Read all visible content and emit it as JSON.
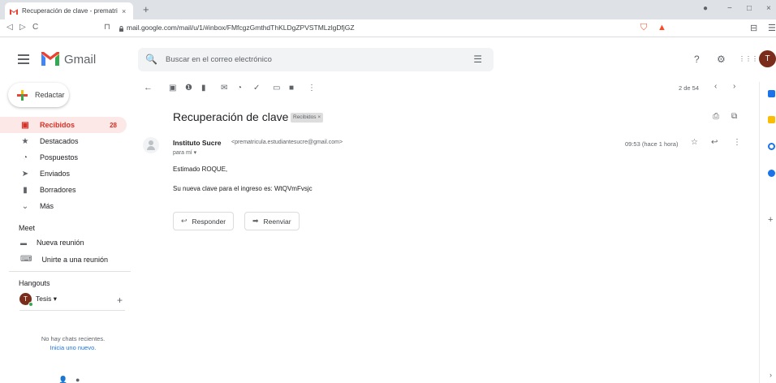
{
  "browser": {
    "tab_title": "Recuperación de clave - prematri",
    "tab_close": "×",
    "new_tab": "+",
    "url": "mail.google.com/mail/u/1/#inbox/FMfcgzGmthdThKLDgZPVSTMLzlgDfjGZ",
    "nav": {
      "back": "◁",
      "forward": "▷",
      "reload": "C",
      "bookmark": "⊓"
    },
    "window": {
      "minimize": "−",
      "maximize": "□",
      "close": "×",
      "profile": "●"
    },
    "ext_icons": {
      "shield": "⛉",
      "triangle": "▲",
      "sidebar": "⊟",
      "menu": "☰"
    },
    "icons": [
      "back-icon",
      "forward-icon",
      "reload-icon",
      "bookmark-icon",
      "lock-icon",
      "brave-shield-icon",
      "rewards-icon"
    ]
  },
  "header": {
    "app_name": "Gmail",
    "search_placeholder": "Buscar en el correo electrónico",
    "icon_glyphs": {
      "search": "🔍",
      "tune": "☰",
      "help": "?",
      "settings": "⚙",
      "apps": "⋮⋮⋮"
    },
    "avatar_letter": "T",
    "icons": [
      "menu-icon",
      "gmail-logo",
      "search-icon",
      "tune-icon",
      "help-icon",
      "settings-icon",
      "apps-icon"
    ]
  },
  "compose": {
    "label": "Redactar"
  },
  "sidebar": {
    "items": [
      {
        "label": "Recibidos",
        "count": "28",
        "icon": "inbox-icon",
        "glyph": "▣",
        "active": true
      },
      {
        "label": "Destacados",
        "icon": "star-icon",
        "glyph": "★"
      },
      {
        "label": "Pospuestos",
        "icon": "clock-icon",
        "glyph": "◔"
      },
      {
        "label": "Enviados",
        "icon": "send-icon",
        "glyph": "➤"
      },
      {
        "label": "Borradores",
        "icon": "draft-icon",
        "glyph": "▮"
      },
      {
        "label": "Más",
        "icon": "chevron-down-icon",
        "glyph": "⌄"
      }
    ],
    "meet": {
      "title": "Meet",
      "new_meeting": "Nueva reunión",
      "join_meeting": "Unirte a una reunión",
      "icons": {
        "video": "▬",
        "keyboard": "⌨"
      }
    },
    "hangouts": {
      "title": "Hangouts",
      "user": "Tesis ▾",
      "avatar_letter": "T",
      "add": "+",
      "no_chats": "No hay chats recientes.",
      "start_new": "Inicia uno nuevo."
    }
  },
  "toolbar": {
    "icon_glyphs": {
      "back": "←",
      "archive": "▣",
      "report": "❶",
      "delete": "▮",
      "mark_unread": "✉",
      "snooze": "◔",
      "add_task": "✓",
      "move": "▭",
      "label": "■",
      "more": "⋮"
    },
    "pager_text": "2 de 54",
    "prev": "‹",
    "next": "›",
    "icons": [
      "back-arrow-icon",
      "archive-icon",
      "report-spam-icon",
      "trash-icon",
      "mark-unread-icon",
      "snooze-icon",
      "add-task-icon",
      "move-to-icon",
      "label-icon",
      "more-icon"
    ]
  },
  "message": {
    "subject": "Recuperación de clave",
    "label_chip": "Recibidos ×",
    "subject_icons": {
      "print": "⎙",
      "open_new": "⧉"
    },
    "sender_name": "Instituto Sucre",
    "sender_email": "<prematricula.estudiantesucre@gmail.com>",
    "to": "para mí ▾",
    "time": "09:53 (hace 1 hora)",
    "action_icons": {
      "star": "☆",
      "reply": "↩",
      "more": "⋮"
    },
    "greeting": "Estimado ROQUE,",
    "body": "Su nueva clave para el ingreso es: WtQVmFvsjc",
    "reply_label": "Responder",
    "forward_label": "Reenviar",
    "reply_glyph": "↩",
    "forward_glyph": "➡"
  },
  "right_panel": {
    "icons": [
      "calendar-icon",
      "keep-icon",
      "tasks-icon",
      "contacts-icon"
    ],
    "colors": [
      "#1a73e8",
      "#fbbc04",
      "#1a73e8",
      "#1a73e8"
    ],
    "add": "+",
    "expand": "›"
  },
  "bottom_icons": {
    "person": "👤",
    "phone": "●"
  },
  "colors": {
    "accent_red": "#d93025",
    "active_bg": "#fce8e6",
    "link": "#1a73e8"
  }
}
